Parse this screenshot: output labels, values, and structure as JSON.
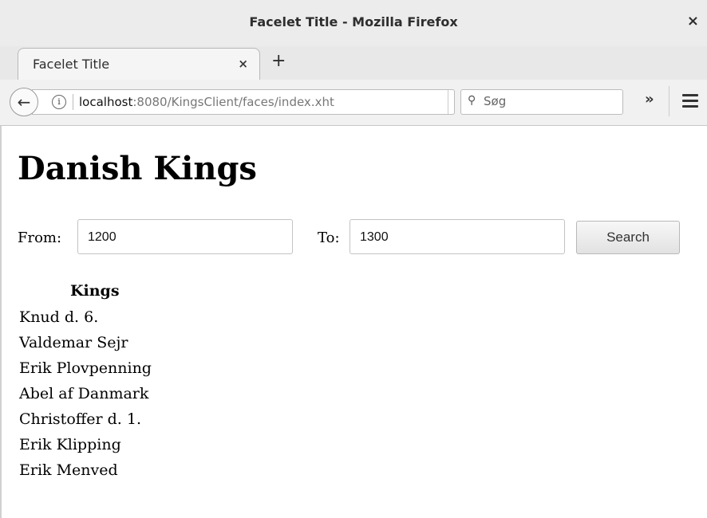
{
  "window": {
    "title": "Facelet Title - Mozilla Firefox",
    "close_glyph": "×"
  },
  "tabs": [
    {
      "label": "Facelet Title",
      "close_glyph": "×"
    }
  ],
  "new_tab_glyph": "+",
  "navbar": {
    "back_glyph": "←",
    "info_glyph": "i",
    "url_host": "localhost",
    "url_rest": ":8080/KingsClient/faces/index.xht",
    "reload_glyph": "↻",
    "search_placeholder": "Søg",
    "search_icon_glyph": "⚲",
    "overflow_glyph": "»"
  },
  "page": {
    "heading": "Danish Kings",
    "from_label": "From:",
    "from_value": "1200",
    "to_label": "To:",
    "to_value": "1300",
    "search_button": "Search",
    "kings_header": "Kings",
    "kings": [
      "Knud d. 6.",
      "Valdemar Sejr",
      "Erik Plovpenning",
      "Abel af Danmark",
      "Christoffer d. 1.",
      "Erik Klipping",
      "Erik Menved"
    ]
  }
}
